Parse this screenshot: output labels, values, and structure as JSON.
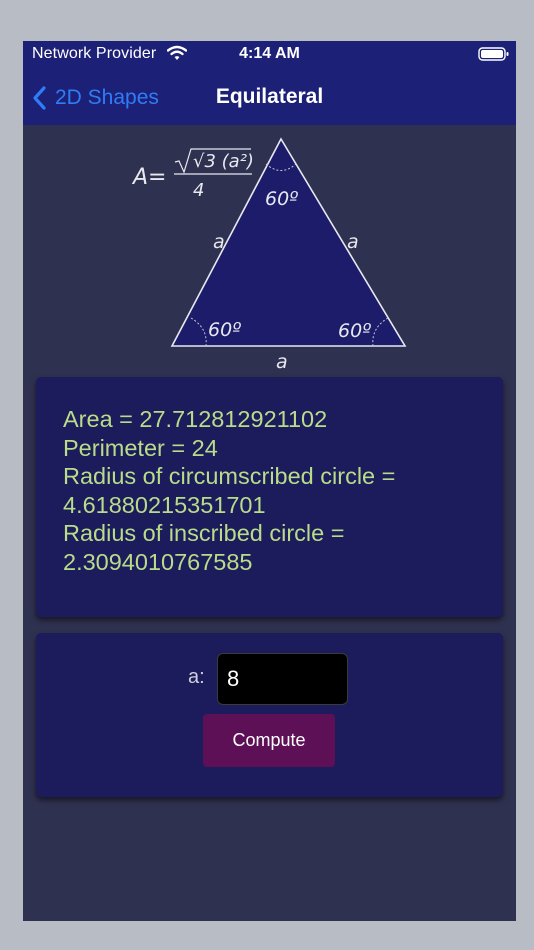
{
  "status_bar": {
    "carrier": "Network Provider",
    "time": "4:14 AM",
    "wifi_icon": "wifi-icon",
    "battery_icon": "battery-full-icon"
  },
  "nav": {
    "back_label": "2D Shapes",
    "back_icon": "chevron-left-icon",
    "title": "Equilateral",
    "accent_color": "#2f7df6",
    "background_color": "#1c2077"
  },
  "diagram": {
    "formula_prefix": "A=",
    "formula_numerator": "√3 (a²)",
    "formula_denominator": "4",
    "side_label": "a",
    "angle_label": "60º",
    "fill_color": "#1c1c6b"
  },
  "results": {
    "area_line": "Area = 27.712812921102",
    "perimeter_line": "Perimeter = 24",
    "circumscribed_label": "Radius of circumscribed circle =",
    "circumscribed_value": "4.61880215351701",
    "inscribed_label": "Radius of inscribed circle =",
    "inscribed_value": "2.3094010767585",
    "text_color": "#b9dc8a"
  },
  "input": {
    "label": "a:",
    "value": "8"
  },
  "compute_button": {
    "label": "Compute",
    "color": "#5e1057"
  }
}
